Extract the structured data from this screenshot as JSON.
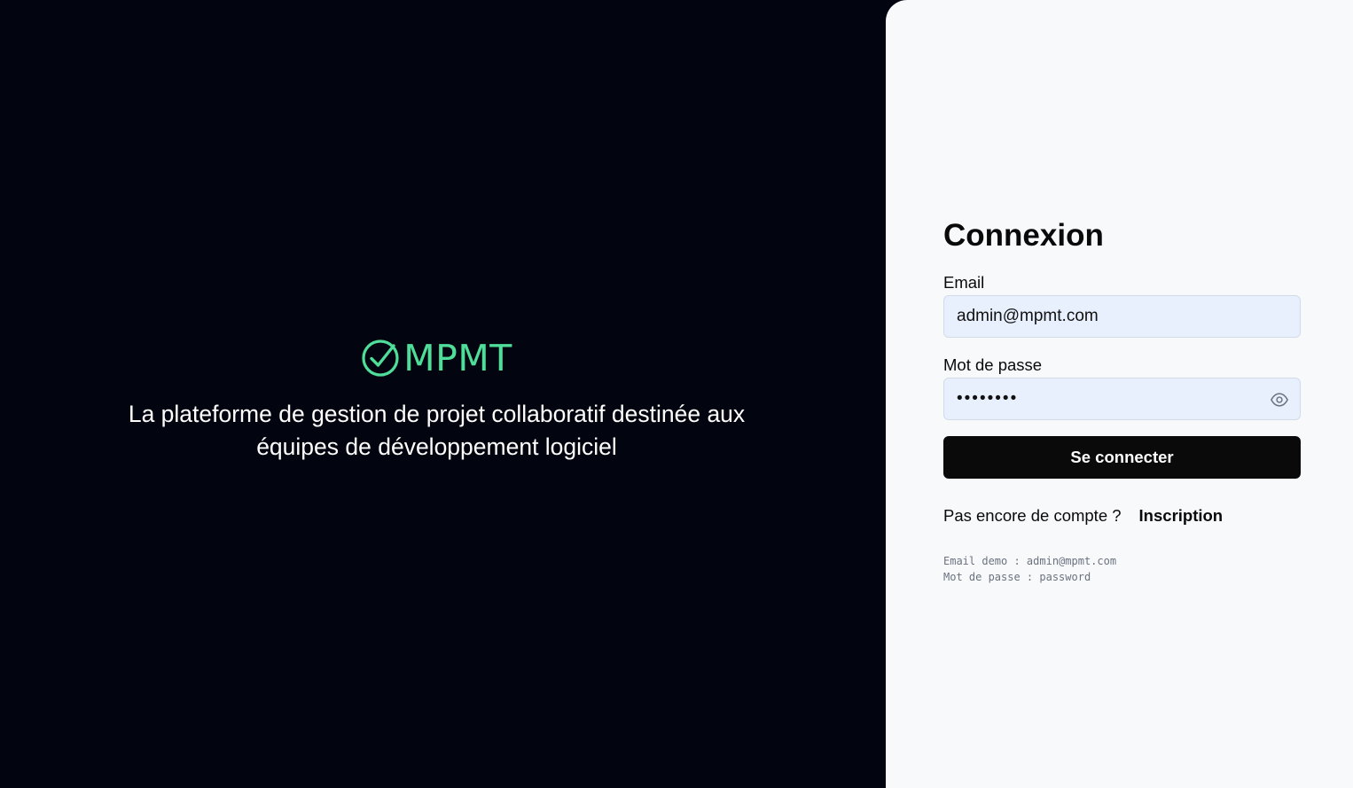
{
  "brand": {
    "name": "MPMT",
    "accent_color": "#4ede9a",
    "icon": "check-circle-icon"
  },
  "tagline": "La plateforme de gestion de projet collaboratif destinée aux équipes de développement logiciel",
  "login": {
    "title": "Connexion",
    "email_label": "Email",
    "email_value": "admin@mpmt.com",
    "password_label": "Mot de passe",
    "password_value": "password",
    "password_toggle_icon": "eye-icon",
    "submit_label": "Se connecter",
    "no_account_text": "Pas encore de compte ?",
    "signup_link": "Inscription",
    "demo_email": "Email demo : admin@mpmt.com",
    "demo_password": "Mot de passe : password"
  },
  "colors": {
    "left_background": "#02040f",
    "right_background": "#f8f9fa",
    "button_background": "#0a0a0a",
    "input_background": "#e8f0fe"
  }
}
